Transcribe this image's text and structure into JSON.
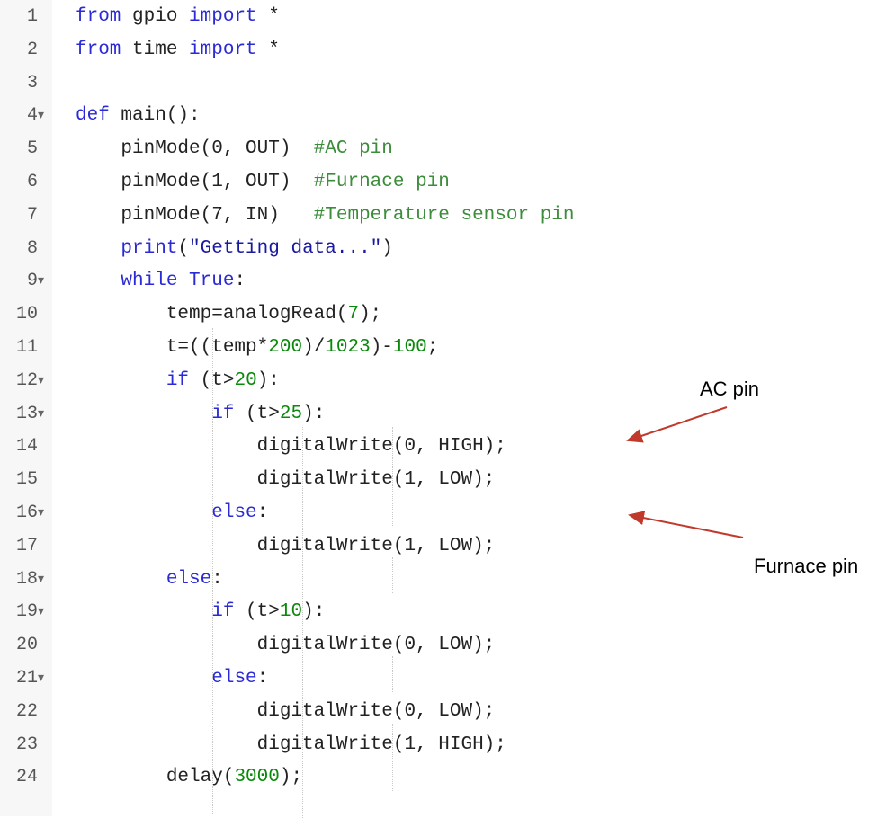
{
  "lines": [
    {
      "n": "1",
      "fold": "",
      "tokens": [
        {
          "t": "kw",
          "v": "from"
        },
        {
          "t": "p",
          "v": " gpio "
        },
        {
          "t": "kw",
          "v": "import"
        },
        {
          "t": "p",
          "v": " *"
        }
      ]
    },
    {
      "n": "2",
      "fold": "",
      "tokens": [
        {
          "t": "kw",
          "v": "from"
        },
        {
          "t": "p",
          "v": " time "
        },
        {
          "t": "kw",
          "v": "import"
        },
        {
          "t": "p",
          "v": " *"
        }
      ]
    },
    {
      "n": "3",
      "fold": "",
      "tokens": []
    },
    {
      "n": "4",
      "fold": "▾",
      "tokens": [
        {
          "t": "kw",
          "v": "def"
        },
        {
          "t": "p",
          "v": " main():"
        }
      ]
    },
    {
      "n": "5",
      "fold": "",
      "tokens": [
        {
          "t": "p",
          "v": "    pinMode(0, OUT)  "
        },
        {
          "t": "cmt",
          "v": "#AC pin"
        }
      ]
    },
    {
      "n": "6",
      "fold": "",
      "tokens": [
        {
          "t": "p",
          "v": "    pinMode(1, OUT)  "
        },
        {
          "t": "cmt",
          "v": "#Furnace pin"
        }
      ]
    },
    {
      "n": "7",
      "fold": "",
      "tokens": [
        {
          "t": "p",
          "v": "    pinMode(7, IN)   "
        },
        {
          "t": "cmt",
          "v": "#Temperature sensor pin"
        }
      ]
    },
    {
      "n": "8",
      "fold": "",
      "tokens": [
        {
          "t": "p",
          "v": "    "
        },
        {
          "t": "kw",
          "v": "print"
        },
        {
          "t": "p",
          "v": "("
        },
        {
          "t": "str",
          "v": "\"Getting data...\""
        },
        {
          "t": "p",
          "v": ")"
        }
      ]
    },
    {
      "n": "9",
      "fold": "▾",
      "tokens": [
        {
          "t": "p",
          "v": "    "
        },
        {
          "t": "kw",
          "v": "while"
        },
        {
          "t": "p",
          "v": " "
        },
        {
          "t": "kw",
          "v": "True"
        },
        {
          "t": "p",
          "v": ":"
        }
      ]
    },
    {
      "n": "10",
      "fold": "",
      "tokens": [
        {
          "t": "p",
          "v": "        temp=analogRead("
        },
        {
          "t": "num",
          "v": "7"
        },
        {
          "t": "p",
          "v": ");"
        }
      ]
    },
    {
      "n": "11",
      "fold": "",
      "tokens": [
        {
          "t": "p",
          "v": "        t=((temp*"
        },
        {
          "t": "num",
          "v": "200"
        },
        {
          "t": "p",
          "v": ")/"
        },
        {
          "t": "num",
          "v": "1023"
        },
        {
          "t": "p",
          "v": ")-"
        },
        {
          "t": "num",
          "v": "100"
        },
        {
          "t": "p",
          "v": ";"
        }
      ]
    },
    {
      "n": "12",
      "fold": "▾",
      "tokens": [
        {
          "t": "p",
          "v": "        "
        },
        {
          "t": "kw",
          "v": "if"
        },
        {
          "t": "p",
          "v": " (t>"
        },
        {
          "t": "num",
          "v": "20"
        },
        {
          "t": "p",
          "v": "):"
        }
      ]
    },
    {
      "n": "13",
      "fold": "▾",
      "tokens": [
        {
          "t": "p",
          "v": "            "
        },
        {
          "t": "kw",
          "v": "if"
        },
        {
          "t": "p",
          "v": " (t>"
        },
        {
          "t": "num",
          "v": "25"
        },
        {
          "t": "p",
          "v": "):"
        }
      ]
    },
    {
      "n": "14",
      "fold": "",
      "tokens": [
        {
          "t": "p",
          "v": "                digitalWrite(0, HIGH);"
        }
      ]
    },
    {
      "n": "15",
      "fold": "",
      "tokens": [
        {
          "t": "p",
          "v": "                digitalWrite(1, LOW);"
        }
      ]
    },
    {
      "n": "16",
      "fold": "▾",
      "tokens": [
        {
          "t": "p",
          "v": "            "
        },
        {
          "t": "kw",
          "v": "else"
        },
        {
          "t": "p",
          "v": ":"
        }
      ]
    },
    {
      "n": "17",
      "fold": "",
      "tokens": [
        {
          "t": "p",
          "v": "                digitalWrite(1, LOW);"
        }
      ]
    },
    {
      "n": "18",
      "fold": "▾",
      "tokens": [
        {
          "t": "p",
          "v": "        "
        },
        {
          "t": "kw",
          "v": "else"
        },
        {
          "t": "p",
          "v": ":"
        }
      ]
    },
    {
      "n": "19",
      "fold": "▾",
      "tokens": [
        {
          "t": "p",
          "v": "            "
        },
        {
          "t": "kw",
          "v": "if"
        },
        {
          "t": "p",
          "v": " (t>"
        },
        {
          "t": "num",
          "v": "10"
        },
        {
          "t": "p",
          "v": "):"
        }
      ]
    },
    {
      "n": "20",
      "fold": "",
      "tokens": [
        {
          "t": "p",
          "v": "                digitalWrite(0, LOW);"
        }
      ]
    },
    {
      "n": "21",
      "fold": "▾",
      "tokens": [
        {
          "t": "p",
          "v": "            "
        },
        {
          "t": "kw",
          "v": "else"
        },
        {
          "t": "p",
          "v": ":"
        }
      ]
    },
    {
      "n": "22",
      "fold": "",
      "tokens": [
        {
          "t": "p",
          "v": "                digitalWrite(0, LOW);"
        }
      ]
    },
    {
      "n": "23",
      "fold": "",
      "tokens": [
        {
          "t": "p",
          "v": "                digitalWrite(1, HIGH);"
        }
      ]
    },
    {
      "n": "24",
      "fold": "",
      "tokens": [
        {
          "t": "p",
          "v": "        delay("
        },
        {
          "t": "num",
          "v": "3000"
        },
        {
          "t": "p",
          "v": ");"
        }
      ]
    }
  ],
  "annotations": {
    "ac_pin": "AC pin",
    "furnace_pin": "Furnace pin"
  },
  "colors": {
    "keyword": "#2a2ad6",
    "number": "#0a8a0a",
    "comment": "#3c8c3c",
    "arrow": "#c0392b"
  }
}
